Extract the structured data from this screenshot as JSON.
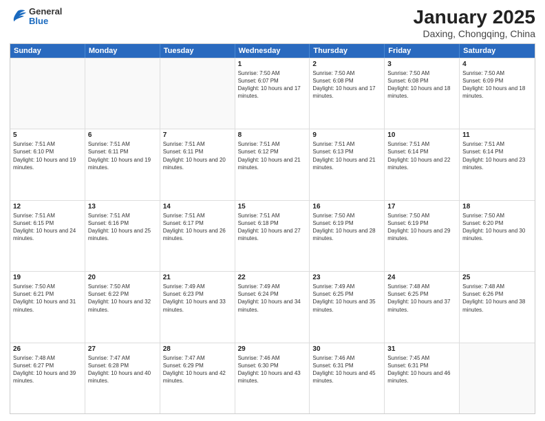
{
  "header": {
    "logo": {
      "general": "General",
      "blue": "Blue"
    },
    "title": "January 2025",
    "subtitle": "Daxing, Chongqing, China"
  },
  "days_of_week": [
    "Sunday",
    "Monday",
    "Tuesday",
    "Wednesday",
    "Thursday",
    "Friday",
    "Saturday"
  ],
  "weeks": [
    [
      {
        "day": "",
        "sunrise": "",
        "sunset": "",
        "daylight": ""
      },
      {
        "day": "",
        "sunrise": "",
        "sunset": "",
        "daylight": ""
      },
      {
        "day": "",
        "sunrise": "",
        "sunset": "",
        "daylight": ""
      },
      {
        "day": "1",
        "sunrise": "Sunrise: 7:50 AM",
        "sunset": "Sunset: 6:07 PM",
        "daylight": "Daylight: 10 hours and 17 minutes."
      },
      {
        "day": "2",
        "sunrise": "Sunrise: 7:50 AM",
        "sunset": "Sunset: 6:08 PM",
        "daylight": "Daylight: 10 hours and 17 minutes."
      },
      {
        "day": "3",
        "sunrise": "Sunrise: 7:50 AM",
        "sunset": "Sunset: 6:08 PM",
        "daylight": "Daylight: 10 hours and 18 minutes."
      },
      {
        "day": "4",
        "sunrise": "Sunrise: 7:50 AM",
        "sunset": "Sunset: 6:09 PM",
        "daylight": "Daylight: 10 hours and 18 minutes."
      }
    ],
    [
      {
        "day": "5",
        "sunrise": "Sunrise: 7:51 AM",
        "sunset": "Sunset: 6:10 PM",
        "daylight": "Daylight: 10 hours and 19 minutes."
      },
      {
        "day": "6",
        "sunrise": "Sunrise: 7:51 AM",
        "sunset": "Sunset: 6:11 PM",
        "daylight": "Daylight: 10 hours and 19 minutes."
      },
      {
        "day": "7",
        "sunrise": "Sunrise: 7:51 AM",
        "sunset": "Sunset: 6:11 PM",
        "daylight": "Daylight: 10 hours and 20 minutes."
      },
      {
        "day": "8",
        "sunrise": "Sunrise: 7:51 AM",
        "sunset": "Sunset: 6:12 PM",
        "daylight": "Daylight: 10 hours and 21 minutes."
      },
      {
        "day": "9",
        "sunrise": "Sunrise: 7:51 AM",
        "sunset": "Sunset: 6:13 PM",
        "daylight": "Daylight: 10 hours and 21 minutes."
      },
      {
        "day": "10",
        "sunrise": "Sunrise: 7:51 AM",
        "sunset": "Sunset: 6:14 PM",
        "daylight": "Daylight: 10 hours and 22 minutes."
      },
      {
        "day": "11",
        "sunrise": "Sunrise: 7:51 AM",
        "sunset": "Sunset: 6:14 PM",
        "daylight": "Daylight: 10 hours and 23 minutes."
      }
    ],
    [
      {
        "day": "12",
        "sunrise": "Sunrise: 7:51 AM",
        "sunset": "Sunset: 6:15 PM",
        "daylight": "Daylight: 10 hours and 24 minutes."
      },
      {
        "day": "13",
        "sunrise": "Sunrise: 7:51 AM",
        "sunset": "Sunset: 6:16 PM",
        "daylight": "Daylight: 10 hours and 25 minutes."
      },
      {
        "day": "14",
        "sunrise": "Sunrise: 7:51 AM",
        "sunset": "Sunset: 6:17 PM",
        "daylight": "Daylight: 10 hours and 26 minutes."
      },
      {
        "day": "15",
        "sunrise": "Sunrise: 7:51 AM",
        "sunset": "Sunset: 6:18 PM",
        "daylight": "Daylight: 10 hours and 27 minutes."
      },
      {
        "day": "16",
        "sunrise": "Sunrise: 7:50 AM",
        "sunset": "Sunset: 6:19 PM",
        "daylight": "Daylight: 10 hours and 28 minutes."
      },
      {
        "day": "17",
        "sunrise": "Sunrise: 7:50 AM",
        "sunset": "Sunset: 6:19 PM",
        "daylight": "Daylight: 10 hours and 29 minutes."
      },
      {
        "day": "18",
        "sunrise": "Sunrise: 7:50 AM",
        "sunset": "Sunset: 6:20 PM",
        "daylight": "Daylight: 10 hours and 30 minutes."
      }
    ],
    [
      {
        "day": "19",
        "sunrise": "Sunrise: 7:50 AM",
        "sunset": "Sunset: 6:21 PM",
        "daylight": "Daylight: 10 hours and 31 minutes."
      },
      {
        "day": "20",
        "sunrise": "Sunrise: 7:50 AM",
        "sunset": "Sunset: 6:22 PM",
        "daylight": "Daylight: 10 hours and 32 minutes."
      },
      {
        "day": "21",
        "sunrise": "Sunrise: 7:49 AM",
        "sunset": "Sunset: 6:23 PM",
        "daylight": "Daylight: 10 hours and 33 minutes."
      },
      {
        "day": "22",
        "sunrise": "Sunrise: 7:49 AM",
        "sunset": "Sunset: 6:24 PM",
        "daylight": "Daylight: 10 hours and 34 minutes."
      },
      {
        "day": "23",
        "sunrise": "Sunrise: 7:49 AM",
        "sunset": "Sunset: 6:25 PM",
        "daylight": "Daylight: 10 hours and 35 minutes."
      },
      {
        "day": "24",
        "sunrise": "Sunrise: 7:48 AM",
        "sunset": "Sunset: 6:25 PM",
        "daylight": "Daylight: 10 hours and 37 minutes."
      },
      {
        "day": "25",
        "sunrise": "Sunrise: 7:48 AM",
        "sunset": "Sunset: 6:26 PM",
        "daylight": "Daylight: 10 hours and 38 minutes."
      }
    ],
    [
      {
        "day": "26",
        "sunrise": "Sunrise: 7:48 AM",
        "sunset": "Sunset: 6:27 PM",
        "daylight": "Daylight: 10 hours and 39 minutes."
      },
      {
        "day": "27",
        "sunrise": "Sunrise: 7:47 AM",
        "sunset": "Sunset: 6:28 PM",
        "daylight": "Daylight: 10 hours and 40 minutes."
      },
      {
        "day": "28",
        "sunrise": "Sunrise: 7:47 AM",
        "sunset": "Sunset: 6:29 PM",
        "daylight": "Daylight: 10 hours and 42 minutes."
      },
      {
        "day": "29",
        "sunrise": "Sunrise: 7:46 AM",
        "sunset": "Sunset: 6:30 PM",
        "daylight": "Daylight: 10 hours and 43 minutes."
      },
      {
        "day": "30",
        "sunrise": "Sunrise: 7:46 AM",
        "sunset": "Sunset: 6:31 PM",
        "daylight": "Daylight: 10 hours and 45 minutes."
      },
      {
        "day": "31",
        "sunrise": "Sunrise: 7:45 AM",
        "sunset": "Sunset: 6:31 PM",
        "daylight": "Daylight: 10 hours and 46 minutes."
      },
      {
        "day": "",
        "sunrise": "",
        "sunset": "",
        "daylight": ""
      }
    ]
  ]
}
